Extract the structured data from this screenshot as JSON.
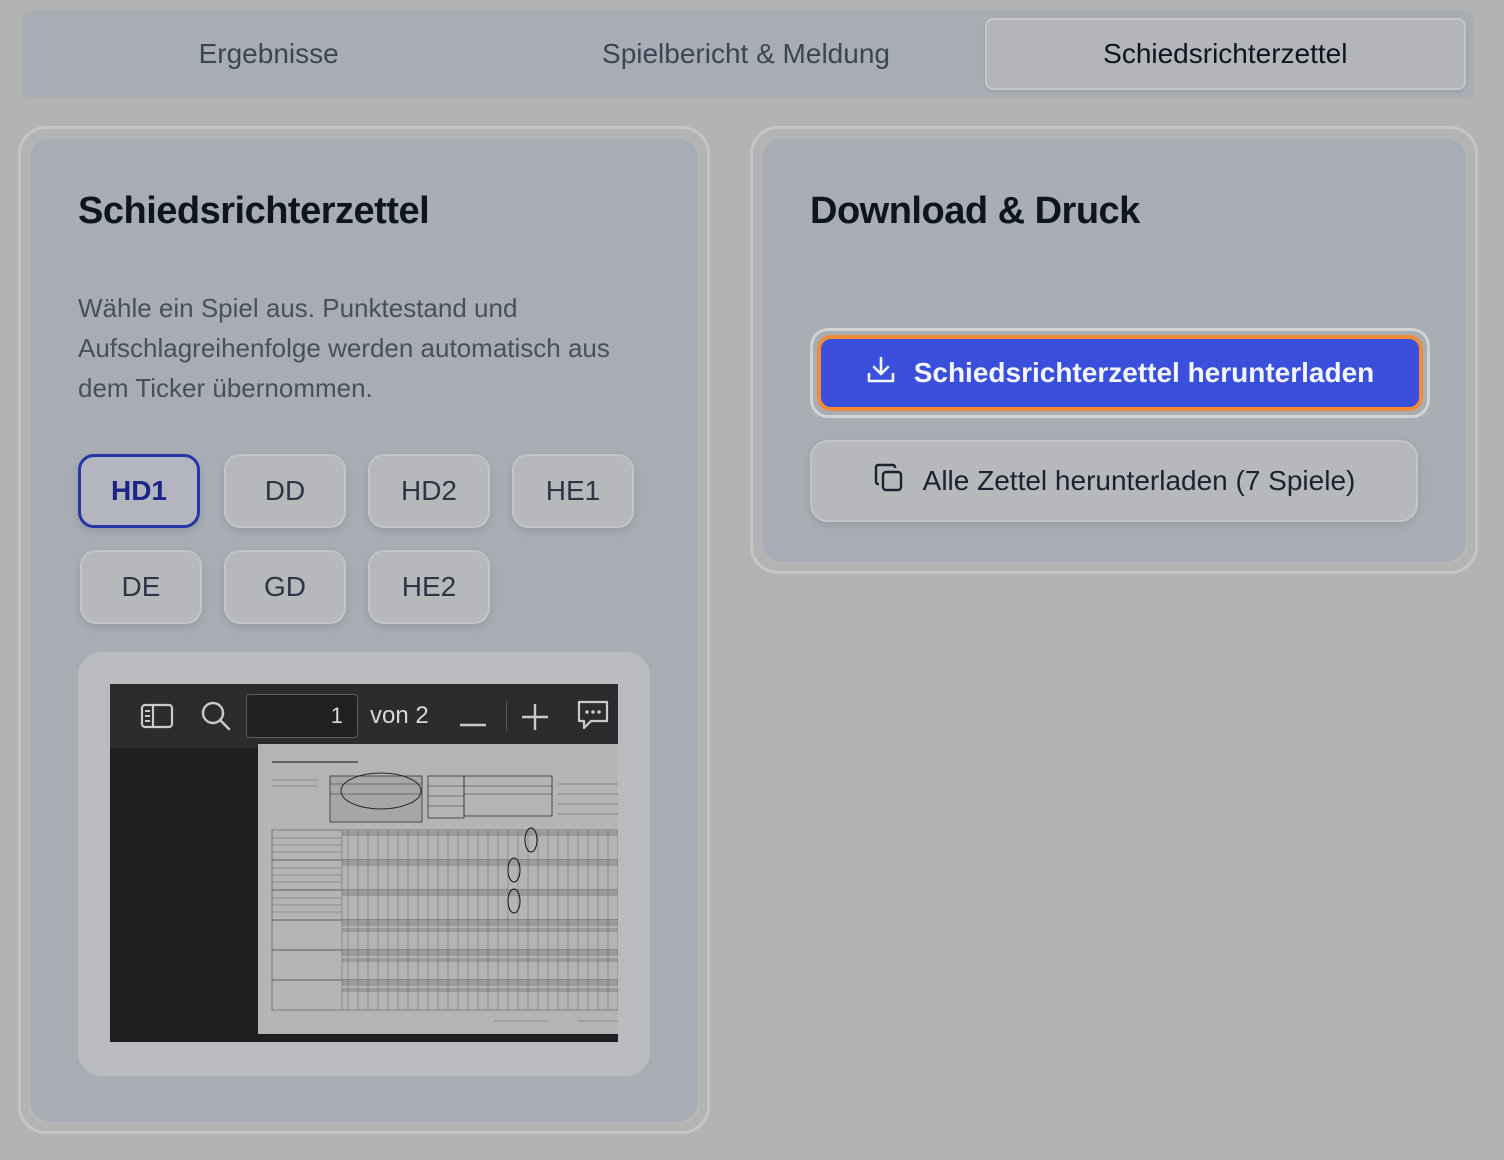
{
  "tabs": [
    {
      "label": "Ergebnisse"
    },
    {
      "label": "Spielbericht & Meldung"
    },
    {
      "label": "Schiedsrichterzettel"
    }
  ],
  "left_card": {
    "title": "Schiedsrichterzettel",
    "description": "Wähle ein Spiel aus. Punktestand und Aufschlagreihenfolge werden automatisch aus dem Ticker übernommen.",
    "matches": [
      "HD1",
      "DD",
      "HD2",
      "HE1",
      "DE",
      "GD",
      "HE2"
    ],
    "selected_match": "HD1",
    "viewer": {
      "page_number": "1",
      "page_of": "von 2"
    }
  },
  "right_card": {
    "title": "Download & Druck",
    "primary_button": "Schiedsrichterzettel herunterladen",
    "secondary_button": "Alle Zettel herunterladen (7 Spiele)"
  },
  "icons": {
    "download": "download-icon",
    "copy": "copy-icon",
    "sidebar": "sidebar-toggle-icon",
    "search": "search-icon",
    "zoom_out": "minus-icon",
    "zoom_in": "plus-icon",
    "comment": "comment-icon"
  },
  "colors": {
    "primary": "#3a4fdc",
    "focus_ring": "#f08c35",
    "selected_chip": "#2836a8"
  }
}
